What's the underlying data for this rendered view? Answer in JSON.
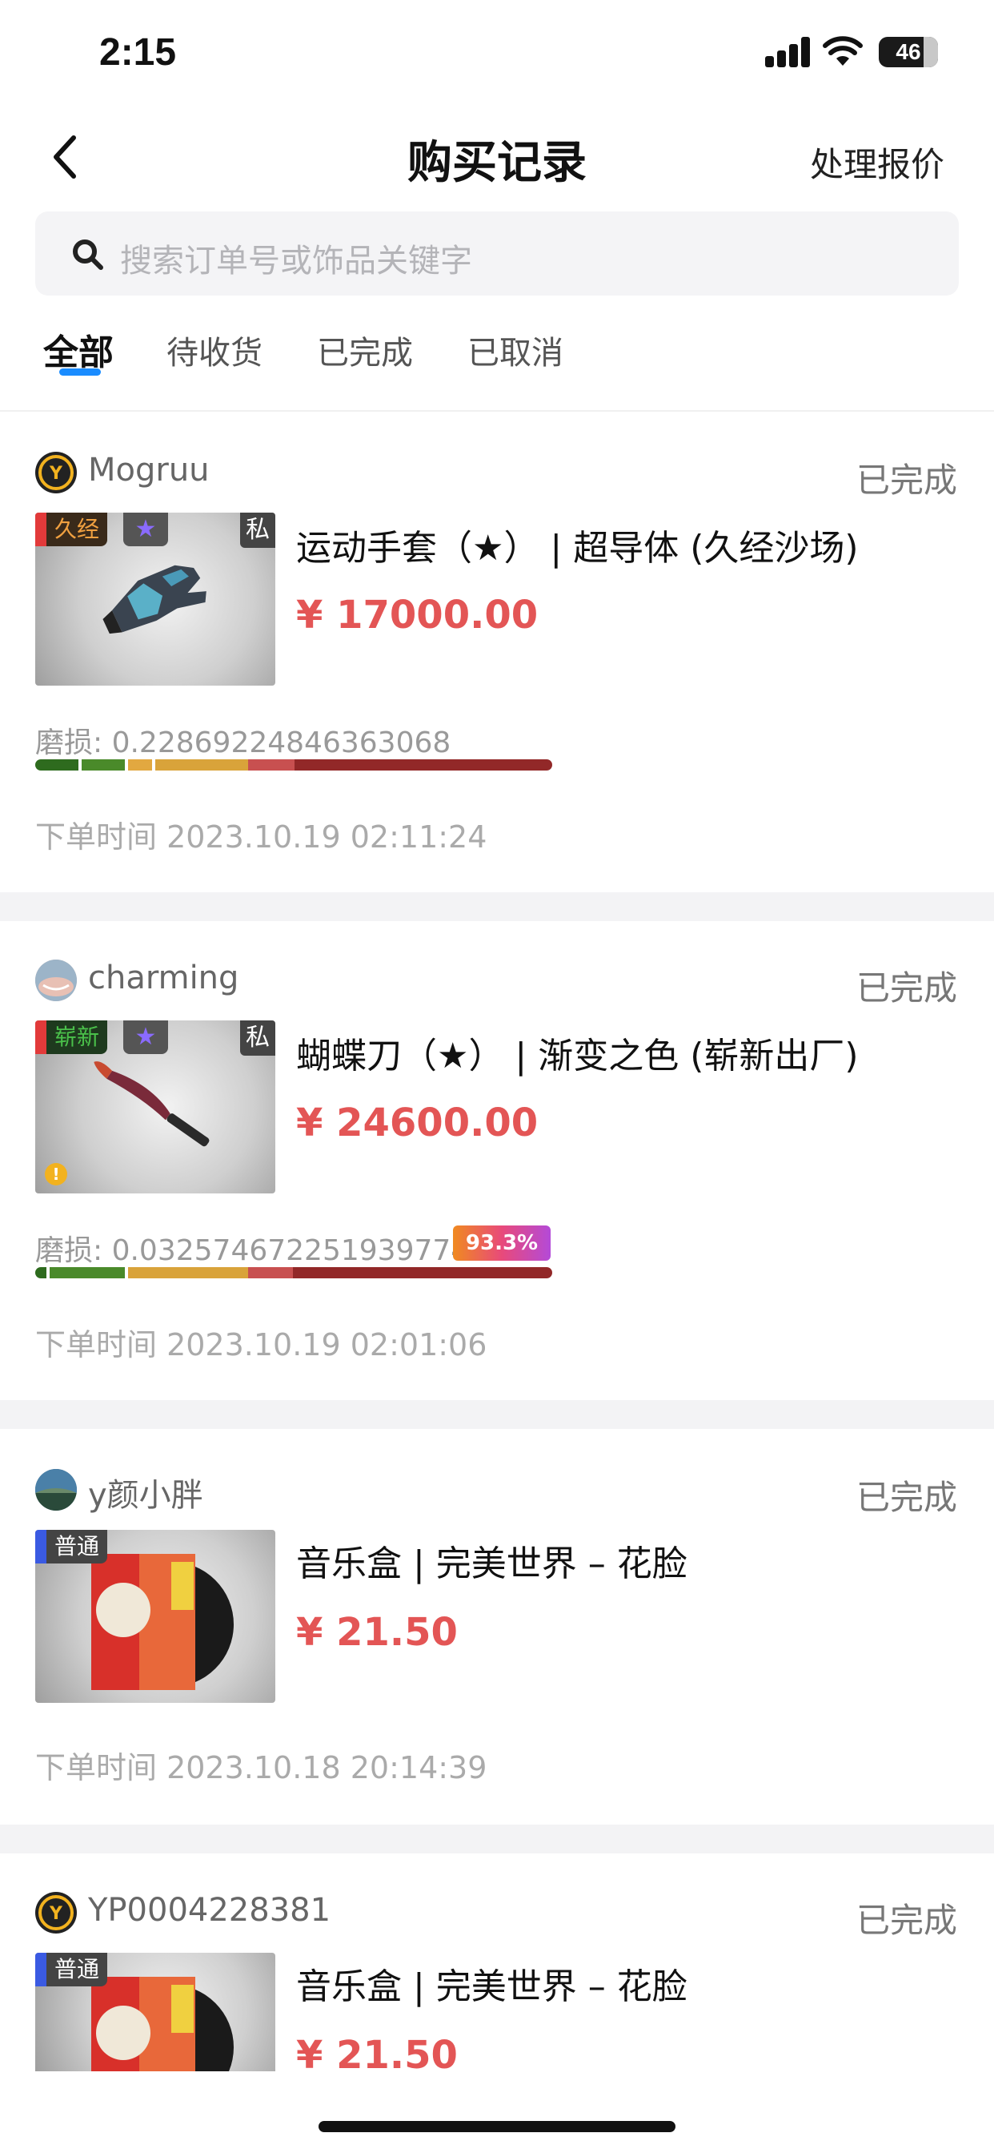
{
  "status_bar": {
    "time": "2:15",
    "battery": "46"
  },
  "nav": {
    "title": "购买记录",
    "action": "处理报价"
  },
  "search": {
    "placeholder": "搜索订单号或饰品关键字"
  },
  "tabs": [
    {
      "label": "全部",
      "active": true
    },
    {
      "label": "待收货",
      "active": false
    },
    {
      "label": "已完成",
      "active": false
    },
    {
      "label": "已取消",
      "active": false
    }
  ],
  "orders": [
    {
      "user": "Mogruu",
      "status": "已完成",
      "item_name": "运动手套（★） | 超导体 (久经沙场)",
      "price": "¥ 17000.00",
      "quality_tag": "久经",
      "star": "★",
      "private": "私",
      "wear": "磨损: 0.22869224846363068",
      "order_time": "下单时间 2023.10.19 02:11:24"
    },
    {
      "user": "charming",
      "status": "已完成",
      "item_name": "蝴蝶刀（★） | 渐变之色 (崭新出厂)",
      "price": "¥ 24600.00",
      "quality_tag": "崭新",
      "star": "★",
      "private": "私",
      "wear": "磨损: 0.032574672251939774",
      "rank_badge": "93.3%",
      "order_time": "下单时间 2023.10.19 02:01:06"
    },
    {
      "user": "y颜小胖",
      "status": "已完成",
      "item_name": "音乐盒 | 完美世界 – 花脸",
      "price": "¥ 21.50",
      "quality_tag": "普通",
      "order_time": "下单时间 2023.10.18 20:14:39"
    },
    {
      "user": "YP0004228381",
      "status": "已完成",
      "item_name": "音乐盒 | 完美世界 – 花脸",
      "price": "¥ 21.50",
      "quality_tag": "普通"
    }
  ],
  "colors": {
    "accent": "#1a8cff",
    "price": "#e35555",
    "tag_worn": "#f0a040",
    "tag_new": "#3aa83a"
  }
}
